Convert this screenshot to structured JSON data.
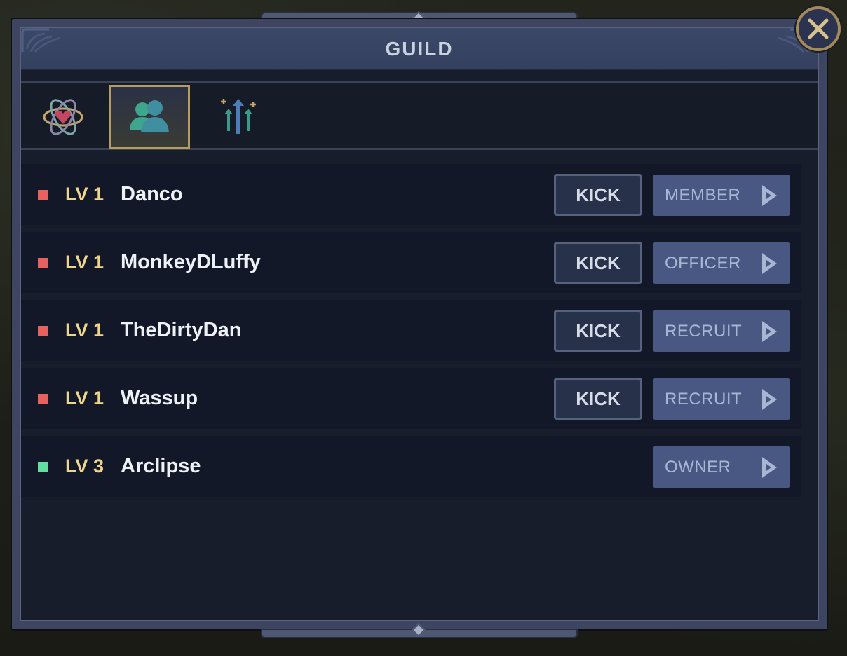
{
  "window": {
    "title": "GUILD"
  },
  "colors": {
    "online": "#5fe0a0",
    "offline": "#e8615e",
    "level": "#efd58a",
    "tab_active_border": "#b89b5e"
  },
  "tabs": [
    {
      "icon": "atom-heart-icon",
      "active": false
    },
    {
      "icon": "members-icon",
      "active": true
    },
    {
      "icon": "upgrade-arrows-icon",
      "active": false
    }
  ],
  "members": [
    {
      "level": "LV 1",
      "name": "Danco",
      "status": "offline",
      "kick": "KICK",
      "rank": "MEMBER"
    },
    {
      "level": "LV 1",
      "name": "MonkeyDLuffy",
      "status": "offline",
      "kick": "KICK",
      "rank": "OFFICER"
    },
    {
      "level": "LV 1",
      "name": "TheDirtyDan",
      "status": "offline",
      "kick": "KICK",
      "rank": "RECRUIT"
    },
    {
      "level": "LV 1",
      "name": "Wassup",
      "status": "offline",
      "kick": "KICK",
      "rank": "RECRUIT"
    },
    {
      "level": "LV 3",
      "name": "Arclipse",
      "status": "online",
      "kick": null,
      "rank": "OWNER"
    }
  ]
}
